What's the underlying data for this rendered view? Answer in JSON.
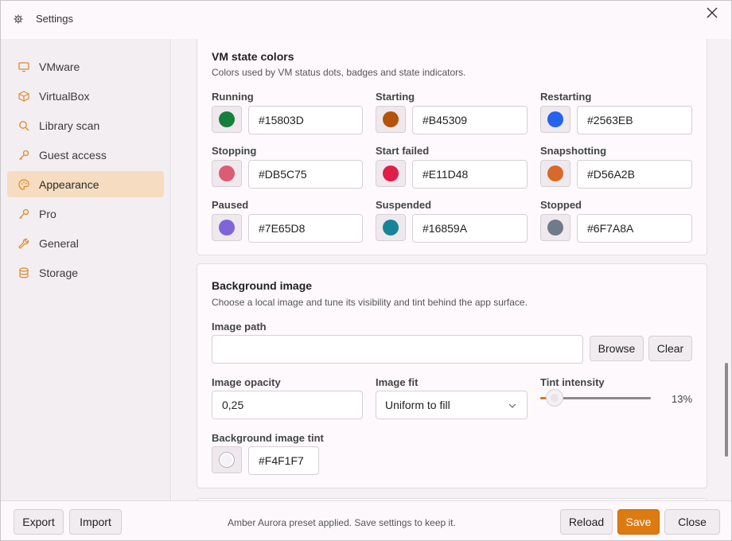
{
  "window": {
    "title": "Settings"
  },
  "sidebar": {
    "items": [
      {
        "label": "VMware",
        "icon": "monitor-icon"
      },
      {
        "label": "VirtualBox",
        "icon": "cube-icon"
      },
      {
        "label": "Library scan",
        "icon": "search-icon"
      },
      {
        "label": "Guest access",
        "icon": "key-icon"
      },
      {
        "label": "Appearance",
        "icon": "palette-icon",
        "active": true
      },
      {
        "label": "Pro",
        "icon": "key-icon"
      },
      {
        "label": "General",
        "icon": "wrench-icon"
      },
      {
        "label": "Storage",
        "icon": "database-icon"
      }
    ],
    "accent": "#e08a2a"
  },
  "vm_colors": {
    "title": "VM state colors",
    "desc": "Colors used by VM status dots, badges and state indicators.",
    "states": [
      {
        "label": "Running",
        "value": "#15803D",
        "color": "#15803D"
      },
      {
        "label": "Starting",
        "value": "#B45309",
        "color": "#B45309"
      },
      {
        "label": "Restarting",
        "value": "#2563EB",
        "color": "#2563EB"
      },
      {
        "label": "Stopping",
        "value": "#DB5C75",
        "color": "#DB5C75"
      },
      {
        "label": "Start failed",
        "value": "#E11D48",
        "color": "#E11D48"
      },
      {
        "label": "Snapshotting",
        "value": "#D56A2B",
        "color": "#D56A2B"
      },
      {
        "label": "Paused",
        "value": "#7E65D8",
        "color": "#7E65D8"
      },
      {
        "label": "Suspended",
        "value": "#16859A",
        "color": "#16859A"
      },
      {
        "label": "Stopped",
        "value": "#6F7A8A",
        "color": "#6F7A8A"
      }
    ]
  },
  "background": {
    "title": "Background image",
    "desc": "Choose a local image and tune its visibility and tint behind the app surface.",
    "image_path_label": "Image path",
    "image_path_value": "",
    "browse_label": "Browse",
    "clear_label": "Clear",
    "opacity_label": "Image opacity",
    "opacity_value": "0,25",
    "fit_label": "Image fit",
    "fit_value": "Uniform to fill",
    "tint_label": "Tint intensity",
    "tint_value": "13%",
    "tint_fraction": 0.13,
    "tint_color_label": "Background image tint",
    "tint_color_value": "#F4F1F7",
    "tint_color": "#F4F1F7"
  },
  "footer": {
    "export_label": "Export",
    "import_label": "Import",
    "status": "Amber Aurora preset applied. Save settings to keep it.",
    "reload_label": "Reload",
    "save_label": "Save",
    "close_label": "Close",
    "save_color": "#DD7A12"
  }
}
